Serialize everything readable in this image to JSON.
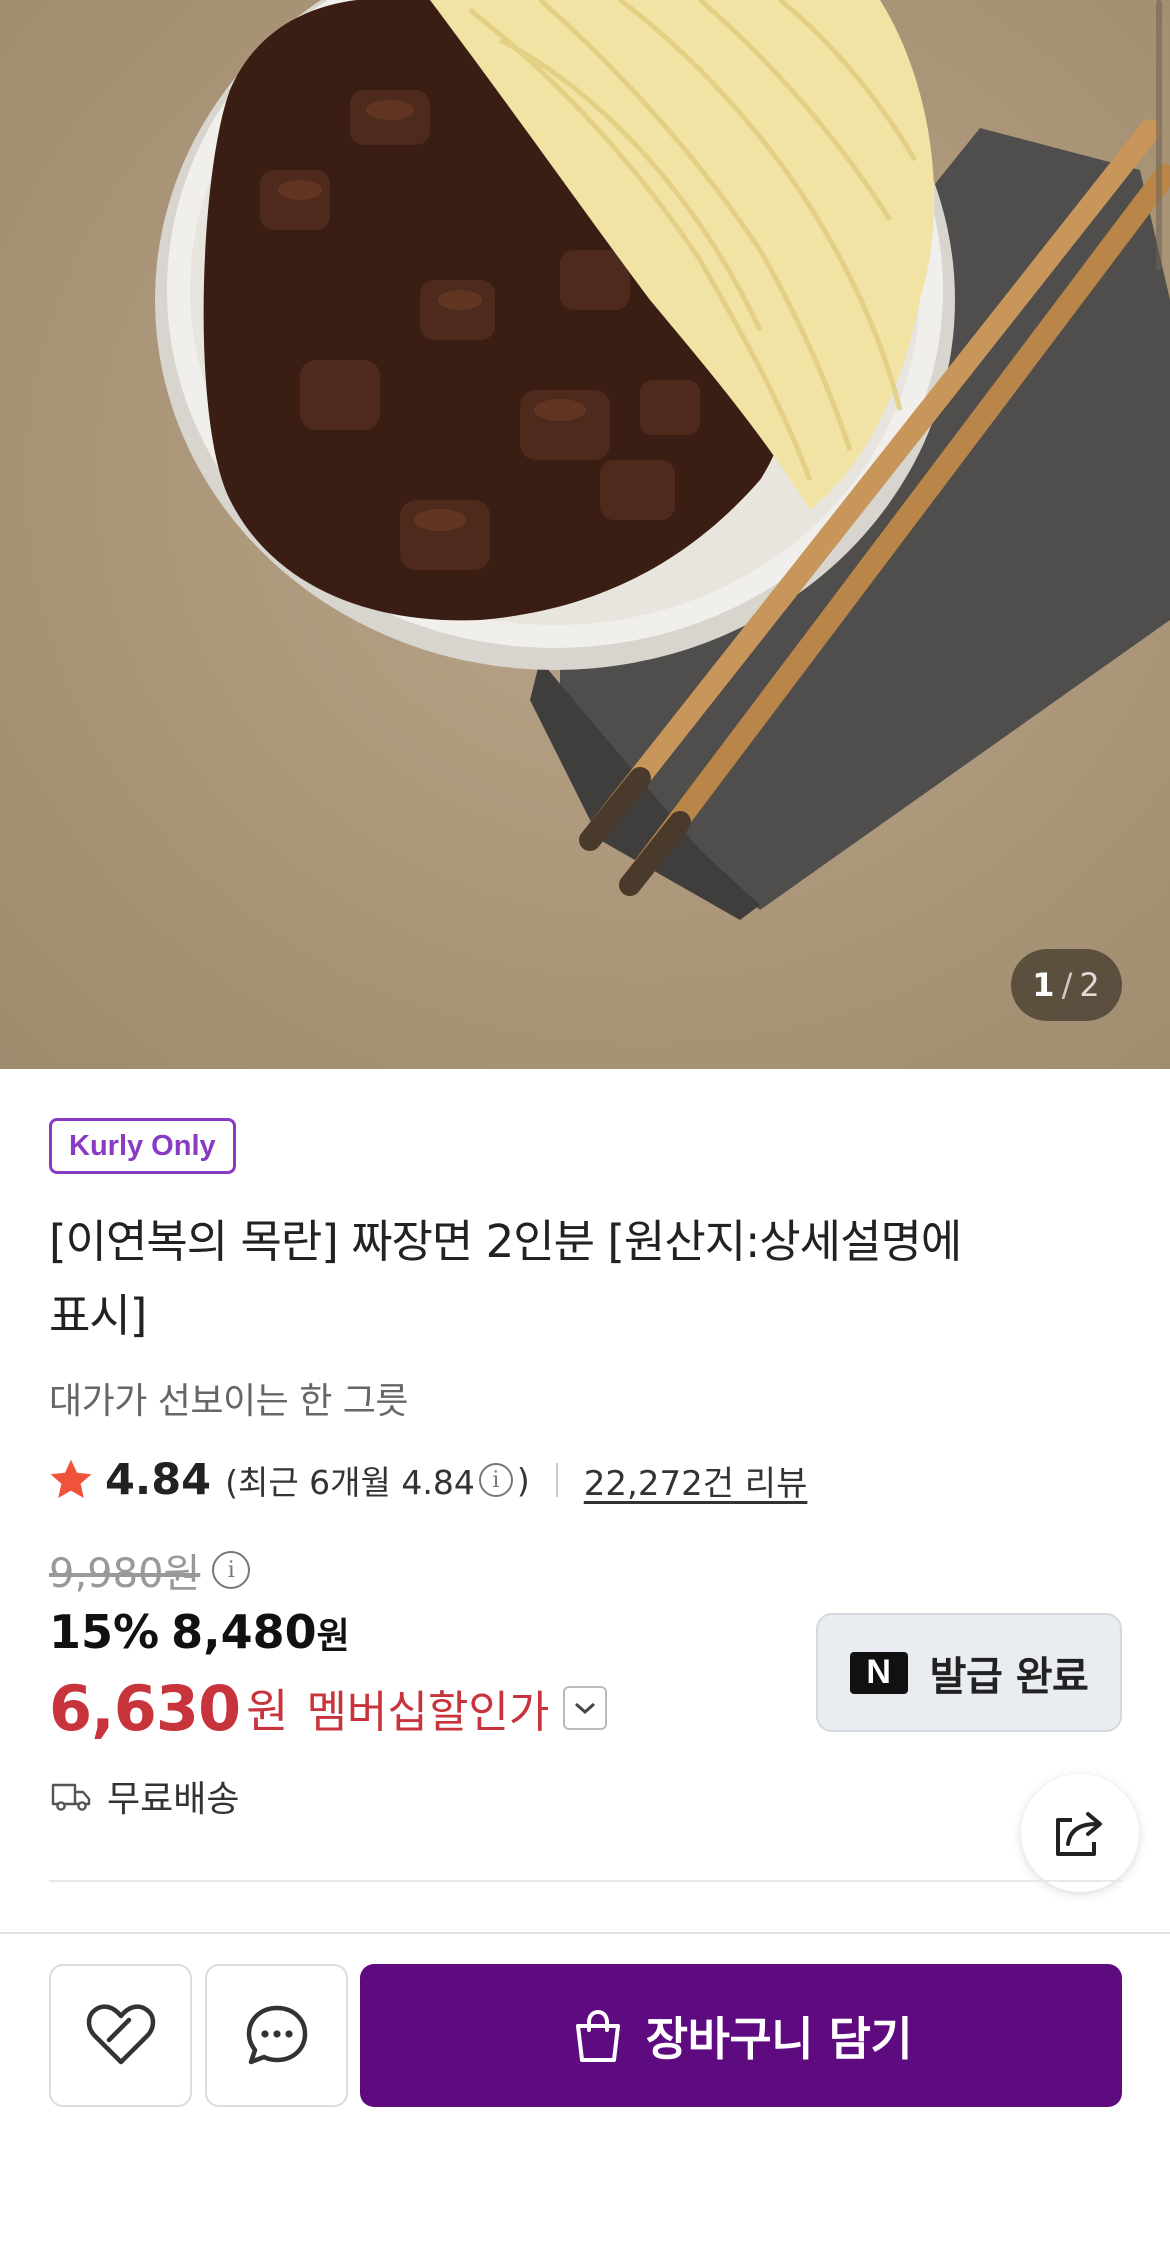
{
  "gallery": {
    "current_page": "1",
    "separator": "/",
    "total_pages": "2",
    "image_subject": "jjajangmyeon-bowl-photo"
  },
  "product": {
    "badge": "Kurly Only",
    "title_line1": "[이연복의 목란] 짜장면 2인분 [원산지:상세설명에",
    "title_line2": "표시]",
    "subtitle": "대가가 선보이는 한 그릇",
    "rating": "4.84",
    "recent_rating_prefix": "(최근 6개월 4.84",
    "recent_rating_suffix": ")",
    "review_count": "22,272건 리뷰"
  },
  "price": {
    "original": "9,980원",
    "discount_percent": "15%",
    "sale_price": "8,480",
    "sale_unit": "원",
    "member_price": "6,630",
    "member_unit": "원",
    "member_label": "멤버십할인가"
  },
  "coupon": {
    "logo_letter": "N",
    "status": "발급 완료"
  },
  "delivery": {
    "text": "무료배송"
  },
  "actions": {
    "cart_label": "장바구니 담기"
  },
  "colors": {
    "brand_purple": "#5f0b80",
    "badge_purple": "#8a3bc4",
    "member_red": "#c8343c",
    "star_red": "#f0523a"
  },
  "icons": [
    "info-icon",
    "star-icon",
    "chevron-down-icon",
    "truck-icon",
    "share-icon",
    "heart-icon",
    "chat-icon",
    "shopping-bag-icon"
  ]
}
